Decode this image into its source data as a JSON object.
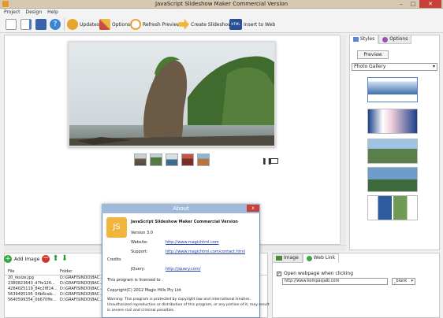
{
  "window": {
    "title": "JavaScript Slideshow Maker Commercial Version",
    "minimize": "–",
    "maximize": "□",
    "close": "✕"
  },
  "menu": [
    "Project",
    "Design",
    "Help"
  ],
  "toolbar": {
    "updates": "Updates",
    "options": "Options",
    "refresh": "Refresh Preview",
    "create": "Create Slideshow",
    "insert": "Insert to Web",
    "html_badge": "HTML"
  },
  "right_panel": {
    "tab_styles": "Styles",
    "tab_options": "Options",
    "preview_button": "Preview",
    "gallery_select": "Photo Gallery"
  },
  "images_bar": {
    "add_image": "Add Image"
  },
  "file_table": {
    "columns": [
      "File",
      "Folder"
    ],
    "rows": [
      {
        "file": "20_resize.jpg",
        "folder": "D:\\GRAFISINDO\\BAC..."
      },
      {
        "file": "2380823643_d7fe126...",
        "folder": "D:\\GRAFISINDO\\BAC..."
      },
      {
        "file": "4284025119_84c2f814...",
        "folder": "D:\\GRAFISINDO\\BAC..."
      },
      {
        "file": "5639495195_04b6cab...",
        "folder": "D:\\GRAFISINDO\\BAC..."
      },
      {
        "file": "5640599354_0b670ffe...",
        "folder": "D:\\GRAFISINDO\\BAC..."
      }
    ]
  },
  "bottom_tabs": {
    "image": "Image",
    "web_link": "Web Link"
  },
  "web_link": {
    "checkbox_label": "Open webpage when clicking",
    "checked": true,
    "url": "http://www.kompasjaib.com",
    "target": "_blank"
  },
  "about": {
    "title": "About",
    "close": "x",
    "product": "JavaScript Slideshow Maker Commercial Version",
    "version": "Version 3.0",
    "website_label": "Website:",
    "website_link": "http://www.magichtml.com",
    "support_label": "Support:",
    "support_link": "http://www.magichtml.com/contact.html",
    "credits_label": "Credits",
    "jquery_label": "jQuery:",
    "jquery_link": "http://jquery.com/",
    "licensed": "This program is licensed to .",
    "copyright": "Copyright(C) 2012 Magic Hills Pty Ltd",
    "warning1": "Warning: This program is protected by copyright law and international treaties.",
    "warning2": "Unauthorized reproduction or distribution of this program, or any portion of it, may result",
    "warning3": "in severe civil and criminal penalties."
  },
  "icons": {
    "pause": "❚❚",
    "arrow_up": "⬆",
    "arrow_down": "⬇",
    "remove": "−",
    "add": "+"
  }
}
